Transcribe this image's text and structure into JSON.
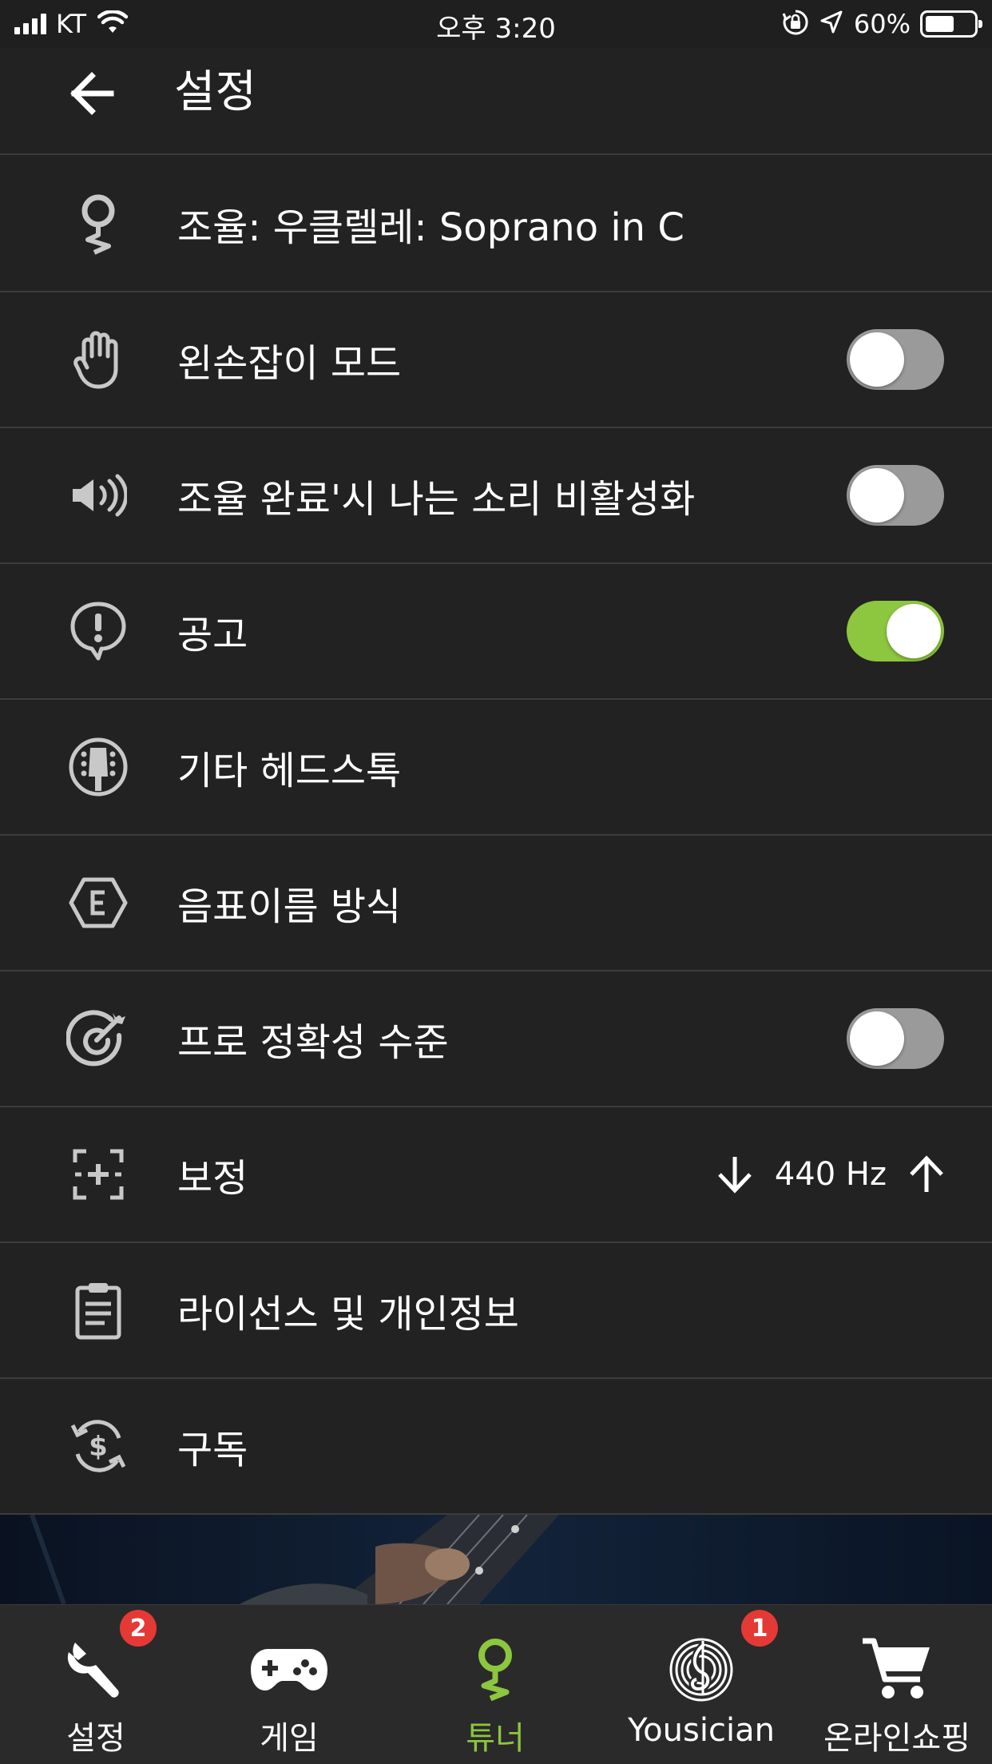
{
  "status_bar": {
    "carrier": "KT",
    "time": "오후 3:20",
    "battery_percent": "60%",
    "battery_level": 0.6
  },
  "header": {
    "title": "설정",
    "back_icon": "arrow-left-icon"
  },
  "settings": [
    {
      "id": "tuning",
      "icon": "tuner-pin-icon",
      "label": "조율: 우클렐레: Soprano in C"
    },
    {
      "id": "lefty",
      "icon": "hand-icon",
      "label": "왼손잡이 모드",
      "toggle": false
    },
    {
      "id": "sound",
      "icon": "speaker-icon",
      "label": "조율 완료'시 나는 소리 비활성화",
      "toggle": false
    },
    {
      "id": "notice",
      "icon": "alert-bubble-icon",
      "label": "공고",
      "toggle": true
    },
    {
      "id": "headstock",
      "icon": "guitar-headstock-icon",
      "label": "기타 헤드스톡"
    },
    {
      "id": "notation",
      "icon": "note-name-icon",
      "label": "음표이름 방식"
    },
    {
      "id": "pro",
      "icon": "target-icon",
      "label": "프로 정확성 수준",
      "toggle": false
    },
    {
      "id": "calibration",
      "icon": "calibration-icon",
      "label": "보정",
      "value": "440 Hz"
    },
    {
      "id": "license",
      "icon": "clipboard-icon",
      "label": "라이선스 및 개인정보"
    },
    {
      "id": "subscription",
      "icon": "subscription-icon",
      "label": "구독"
    }
  ],
  "tabs": [
    {
      "id": "settings",
      "label": "설정",
      "icon": "wrench-icon",
      "badge": "2"
    },
    {
      "id": "games",
      "label": "게임",
      "icon": "gamepad-icon"
    },
    {
      "id": "tuner",
      "label": "튜너",
      "icon": "tuner-pin-icon",
      "active": true
    },
    {
      "id": "yousician",
      "label": "Yousician",
      "icon": "yousician-logo-icon",
      "badge": "1"
    },
    {
      "id": "shop",
      "label": "온라인쇼핑",
      "icon": "cart-icon"
    }
  ],
  "colors": {
    "accent": "#8dc63f",
    "background": "#222222",
    "badge": "#e53935",
    "toggle_off": "#9a9a9a"
  }
}
